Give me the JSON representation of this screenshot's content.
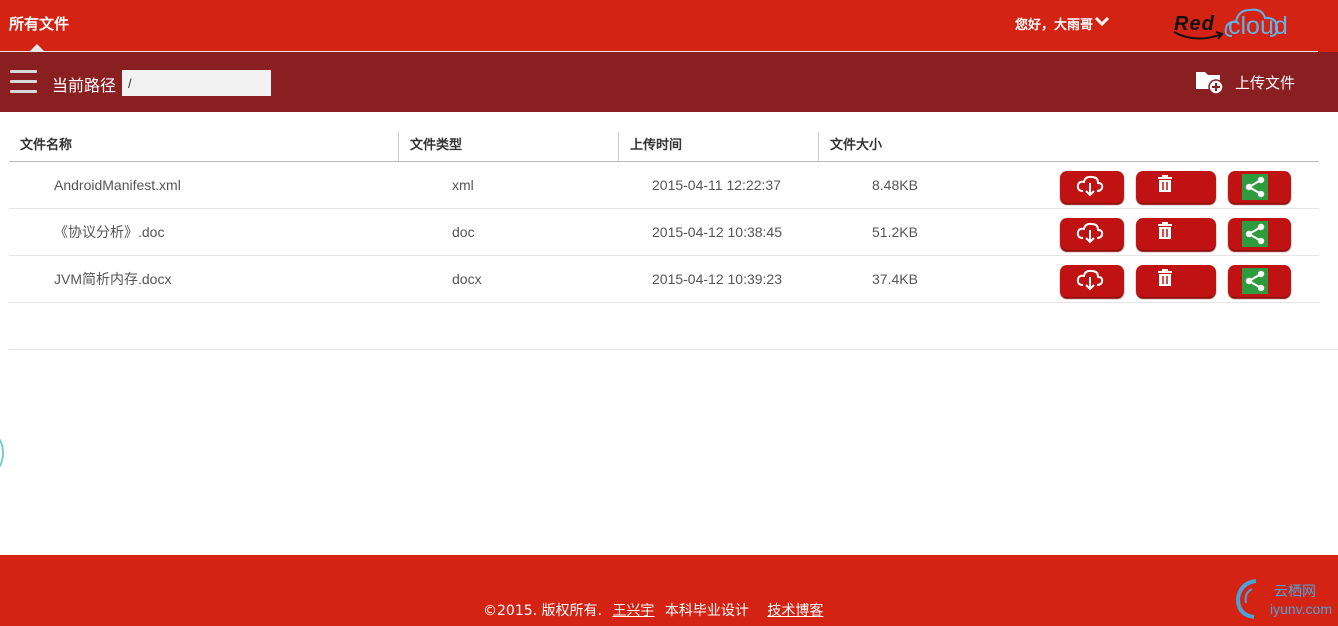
{
  "header": {
    "title": "所有文件",
    "greeting": "您好，大雨哥",
    "logo_red": "Red",
    "logo_cloud": "cloud"
  },
  "pathbar": {
    "label": "当前路径",
    "path_value": "/",
    "upload_label": "上传文件"
  },
  "table": {
    "columns": [
      "文件名称",
      "文件类型",
      "上传时间",
      "文件大小"
    ],
    "rows": [
      {
        "name": "AndroidManifest.xml",
        "type": "xml",
        "time": "2015-04-11 12:22:37",
        "size": "8.48KB"
      },
      {
        "name": "《协议分析》.doc",
        "type": "doc",
        "time": "2015-04-12 10:38:45",
        "size": "51.2KB"
      },
      {
        "name": "JVM简析内存.docx",
        "type": "docx",
        "time": "2015-04-12 10:39:23",
        "size": "37.4KB"
      }
    ],
    "icons": {
      "download": "cloud-download-icon",
      "delete": "trash-icon",
      "share": "share-icon"
    }
  },
  "footer": {
    "copyright": "©2015. 版权所有.",
    "author_link": "王兴宇",
    "middle": "本科毕业设计",
    "blog_link": "技术博客",
    "watermark_top": "云栖网",
    "watermark_bottom": "iyunv.com"
  },
  "colors": {
    "brand_red": "#d42213",
    "path_bar": "#8a1f22",
    "button_red": "#c01212",
    "share_green": "#2e9b3e"
  }
}
